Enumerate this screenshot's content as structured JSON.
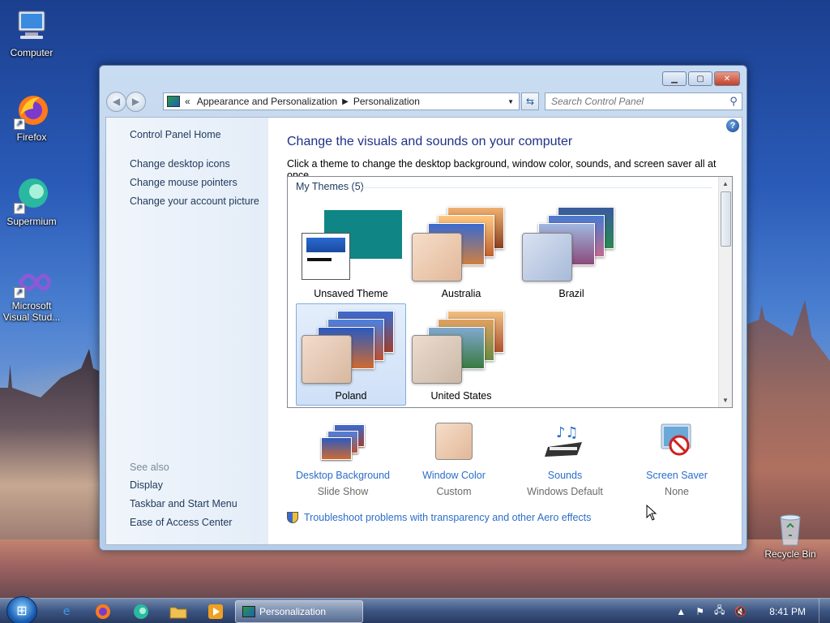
{
  "desktop": {
    "icons": [
      {
        "label": "Computer",
        "icon": "computer-icon"
      },
      {
        "label": "Firefox",
        "icon": "firefox-icon"
      },
      {
        "label": "Supermium",
        "icon": "supermium-icon"
      },
      {
        "label": "Microsoft Visual Stud...",
        "icon": "visual-studio-icon"
      },
      {
        "label": "Recycle Bin",
        "icon": "recycle-bin-icon"
      }
    ]
  },
  "window": {
    "title": "Personalization",
    "breadcrumb": {
      "overflow": "«",
      "items": [
        "Appearance and Personalization",
        "Personalization"
      ]
    },
    "search_placeholder": "Search Control Panel",
    "sidebar": {
      "home": "Control Panel Home",
      "links": [
        "Change desktop icons",
        "Change mouse pointers",
        "Change your account picture"
      ],
      "see_also_title": "See also",
      "see_also": [
        "Display",
        "Taskbar and Start Menu",
        "Ease of Access Center"
      ]
    },
    "main": {
      "heading": "Change the visuals and sounds on your computer",
      "subtitle": "Click a theme to change the desktop background, window color, sounds, and screen saver all at once.",
      "group_header": "My Themes (5)",
      "themes": [
        {
          "name": "Unsaved Theme",
          "selected": false
        },
        {
          "name": "Australia",
          "selected": false
        },
        {
          "name": "Brazil",
          "selected": false
        },
        {
          "name": "Poland",
          "selected": true
        },
        {
          "name": "United States",
          "selected": false
        }
      ],
      "settings": [
        {
          "title": "Desktop Background",
          "value": "Slide Show",
          "icon": "desktop-background-icon"
        },
        {
          "title": "Window Color",
          "value": "Custom",
          "icon": "window-color-icon"
        },
        {
          "title": "Sounds",
          "value": "Windows Default",
          "icon": "sounds-icon"
        },
        {
          "title": "Screen Saver",
          "value": "None",
          "icon": "screen-saver-icon"
        }
      ],
      "troubleshoot": "Troubleshoot problems with transparency and other Aero effects"
    }
  },
  "taskbar": {
    "active_task": "Personalization",
    "clock": "8:41 PM"
  },
  "colors": {
    "link": "#2a6ec8",
    "heading": "#1e3287",
    "nav_link": "#1e395b",
    "teal_background": "#0f8585"
  }
}
